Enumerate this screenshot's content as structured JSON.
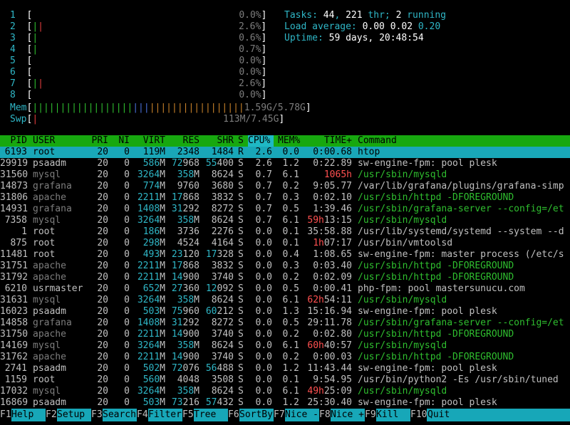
{
  "meters": {
    "cpus": [
      {
        "n": "1",
        "bar": "",
        "bar_green": "",
        "pct": "0.0%"
      },
      {
        "n": "2",
        "bar": "||",
        "bar_green": "|",
        "pct": "2.6%"
      },
      {
        "n": "3",
        "bar": "|",
        "bar_green": "|",
        "pct": "0.6%"
      },
      {
        "n": "4",
        "bar": "|",
        "bar_green": "|",
        "pct": "0.7%"
      },
      {
        "n": "5",
        "bar": "",
        "bar_green": "",
        "pct": "0.0%"
      },
      {
        "n": "6",
        "bar": "",
        "bar_green": "",
        "pct": "0.0%"
      },
      {
        "n": "7",
        "bar": "||",
        "bar_green": "|",
        "pct": "2.6%"
      },
      {
        "n": "8",
        "bar": "",
        "bar_green": "",
        "pct": "0.0%"
      }
    ],
    "mem_label": "Mem",
    "mem_bar": "||||||||||||||||||||||||||||||||||||||",
    "mem_value": "1.59G/5.78G",
    "swp_label": "Swp",
    "swp_bar": "|",
    "swp_value": "113M/7.45G"
  },
  "summary": {
    "tasks_label": "Tasks:",
    "tasks": "44",
    "thr": "221",
    "thr_label": "thr;",
    "running": "2",
    "running_label": "running",
    "load_label": "Load average:",
    "load1": "0.00",
    "load5": "0.02",
    "load15": "0.20",
    "uptime_label": "Uptime:",
    "uptime": "59 days, 20:48:54"
  },
  "header": {
    "pid": "PID",
    "user": "USER",
    "pri": "PRI",
    "ni": "NI",
    "virt": "VIRT",
    "res": "RES",
    "shr": "SHR",
    "s": "S",
    "cpu": "CPU%",
    "mem": "MEM%",
    "time": "TIME+",
    "command": "Command"
  },
  "processes": [
    {
      "pid": "6193",
      "user": "root",
      "pri": "20",
      "ni": "0",
      "virt": "119M",
      "res": "2348",
      "shr": "1484",
      "s": "R",
      "cpu": "2.6",
      "mem": "0.0",
      "time": "0:00.68",
      "cmd": "htop",
      "selected": true
    },
    {
      "pid": "29919",
      "user": "psaadm",
      "pri": "20",
      "ni": "0",
      "virt": "586M",
      "res": "72968",
      "shr": "55400",
      "s": "S",
      "cpu": "2.6",
      "mem": "1.2",
      "time": "0:22.89",
      "cmd": "sw-engine-fpm: pool plesk"
    },
    {
      "pid": "31560",
      "user": "mysql",
      "pri": "20",
      "ni": "0",
      "virt": "3264M",
      "res": "358M",
      "shr": "8624",
      "s": "S",
      "cpu": "0.7",
      "mem": "6.1",
      "time": "1065h",
      "cmd": "/usr/sbin/mysqld"
    },
    {
      "pid": "14873",
      "user": "grafana",
      "pri": "20",
      "ni": "0",
      "virt": "774M",
      "res": "9760",
      "shr": "3680",
      "s": "S",
      "cpu": "0.7",
      "mem": "0.2",
      "time": "9:05.77",
      "cmd": "/var/lib/grafana/plugins/grafana-simp"
    },
    {
      "pid": "31806",
      "user": "apache",
      "pri": "20",
      "ni": "0",
      "virt": "2211M",
      "res": "17868",
      "shr": "3832",
      "s": "S",
      "cpu": "0.7",
      "mem": "0.3",
      "time": "0:02.10",
      "cmd": "/usr/sbin/httpd -DFOREGROUND"
    },
    {
      "pid": "14931",
      "user": "grafana",
      "pri": "20",
      "ni": "0",
      "virt": "1408M",
      "res": "31292",
      "shr": "8272",
      "s": "S",
      "cpu": "0.7",
      "mem": "0.5",
      "time": "1:39.46",
      "cmd": "/usr/sbin/grafana-server --config=/et"
    },
    {
      "pid": "7358",
      "user": "mysql",
      "pri": "20",
      "ni": "0",
      "virt": "3264M",
      "res": "358M",
      "shr": "8624",
      "s": "S",
      "cpu": "0.7",
      "mem": "6.1",
      "time": "59h13:15",
      "cmd": "/usr/sbin/mysqld"
    },
    {
      "pid": "1",
      "user": "root",
      "pri": "20",
      "ni": "0",
      "virt": "186M",
      "res": "3736",
      "shr": "2276",
      "s": "S",
      "cpu": "0.0",
      "mem": "0.1",
      "time": "35:58.88",
      "cmd": "/usr/lib/systemd/systemd --system --d"
    },
    {
      "pid": "875",
      "user": "root",
      "pri": "20",
      "ni": "0",
      "virt": "298M",
      "res": "4524",
      "shr": "4164",
      "s": "S",
      "cpu": "0.0",
      "mem": "0.1",
      "time": "1h07:17",
      "cmd": "/usr/bin/vmtoolsd"
    },
    {
      "pid": "11481",
      "user": "root",
      "pri": "20",
      "ni": "0",
      "virt": "493M",
      "res": "23120",
      "shr": "17328",
      "s": "S",
      "cpu": "0.0",
      "mem": "0.4",
      "time": "1:08.65",
      "cmd": "sw-engine-fpm: master process (/etc/s"
    },
    {
      "pid": "31751",
      "user": "apache",
      "pri": "20",
      "ni": "0",
      "virt": "2211M",
      "res": "17868",
      "shr": "3832",
      "s": "S",
      "cpu": "0.0",
      "mem": "0.3",
      "time": "0:03.40",
      "cmd": "/usr/sbin/httpd -DFOREGROUND"
    },
    {
      "pid": "31792",
      "user": "apache",
      "pri": "20",
      "ni": "0",
      "virt": "2211M",
      "res": "14900",
      "shr": "3740",
      "s": "S",
      "cpu": "0.0",
      "mem": "0.2",
      "time": "0:02.09",
      "cmd": "/usr/sbin/httpd -DFOREGROUND"
    },
    {
      "pid": "6210",
      "user": "usrmaster",
      "pri": "20",
      "ni": "0",
      "virt": "652M",
      "res": "27360",
      "shr": "12092",
      "s": "S",
      "cpu": "0.0",
      "mem": "0.5",
      "time": "0:00.41",
      "cmd": "php-fpm: pool mastersunucu.com"
    },
    {
      "pid": "31631",
      "user": "mysql",
      "pri": "20",
      "ni": "0",
      "virt": "3264M",
      "res": "358M",
      "shr": "8624",
      "s": "S",
      "cpu": "0.0",
      "mem": "6.1",
      "time": "62h54:11",
      "cmd": "/usr/sbin/mysqld"
    },
    {
      "pid": "16023",
      "user": "psaadm",
      "pri": "20",
      "ni": "0",
      "virt": "503M",
      "res": "75960",
      "shr": "60212",
      "s": "S",
      "cpu": "0.0",
      "mem": "1.3",
      "time": "15:16.94",
      "cmd": "sw-engine-fpm: pool plesk"
    },
    {
      "pid": "14858",
      "user": "grafana",
      "pri": "20",
      "ni": "0",
      "virt": "1408M",
      "res": "31292",
      "shr": "8272",
      "s": "S",
      "cpu": "0.0",
      "mem": "0.5",
      "time": "29:11.78",
      "cmd": "/usr/sbin/grafana-server --config=/et"
    },
    {
      "pid": "31750",
      "user": "apache",
      "pri": "20",
      "ni": "0",
      "virt": "2211M",
      "res": "14900",
      "shr": "3740",
      "s": "S",
      "cpu": "0.0",
      "mem": "0.2",
      "time": "0:02.80",
      "cmd": "/usr/sbin/httpd -DFOREGROUND"
    },
    {
      "pid": "14169",
      "user": "mysql",
      "pri": "20",
      "ni": "0",
      "virt": "3264M",
      "res": "358M",
      "shr": "8624",
      "s": "S",
      "cpu": "0.0",
      "mem": "6.1",
      "time": "60h40:57",
      "cmd": "/usr/sbin/mysqld"
    },
    {
      "pid": "31762",
      "user": "apache",
      "pri": "20",
      "ni": "0",
      "virt": "2211M",
      "res": "14900",
      "shr": "3740",
      "s": "S",
      "cpu": "0.0",
      "mem": "0.2",
      "time": "0:00.03",
      "cmd": "/usr/sbin/httpd -DFOREGROUND"
    },
    {
      "pid": "2741",
      "user": "psaadm",
      "pri": "20",
      "ni": "0",
      "virt": "502M",
      "res": "72076",
      "shr": "56488",
      "s": "S",
      "cpu": "0.0",
      "mem": "1.2",
      "time": "11:43.44",
      "cmd": "sw-engine-fpm: pool plesk"
    },
    {
      "pid": "1159",
      "user": "root",
      "pri": "20",
      "ni": "0",
      "virt": "560M",
      "res": "4048",
      "shr": "3508",
      "s": "S",
      "cpu": "0.0",
      "mem": "0.1",
      "time": "9:54.95",
      "cmd": "/usr/bin/python2 -Es /usr/sbin/tuned"
    },
    {
      "pid": "17032",
      "user": "mysql",
      "pri": "20",
      "ni": "0",
      "virt": "3264M",
      "res": "358M",
      "shr": "8624",
      "s": "S",
      "cpu": "0.0",
      "mem": "6.1",
      "time": "49h25:09",
      "cmd": "/usr/sbin/mysqld"
    },
    {
      "pid": "16869",
      "user": "psaadm",
      "pri": "20",
      "ni": "0",
      "virt": "503M",
      "res": "73216",
      "shr": "57432",
      "s": "S",
      "cpu": "0.0",
      "mem": "1.2",
      "time": "25:30.40",
      "cmd": "sw-engine-fpm: pool plesk"
    }
  ],
  "fkeys": [
    {
      "k": "F1",
      "l": "Help"
    },
    {
      "k": "F2",
      "l": "Setup"
    },
    {
      "k": "F3",
      "l": "Search"
    },
    {
      "k": "F4",
      "l": "Filter"
    },
    {
      "k": "F5",
      "l": "Tree"
    },
    {
      "k": "F6",
      "l": "SortBy"
    },
    {
      "k": "F7",
      "l": "Nice -"
    },
    {
      "k": "F8",
      "l": "Nice +"
    },
    {
      "k": "F9",
      "l": "Kill"
    },
    {
      "k": "F10",
      "l": "Quit"
    }
  ],
  "colors": {
    "header_bg": "#17a80f",
    "selected_bg": "#19a7b8",
    "green": "#2fbf2f",
    "cyan": "#2fb7c7",
    "red": "#e43d3d"
  }
}
